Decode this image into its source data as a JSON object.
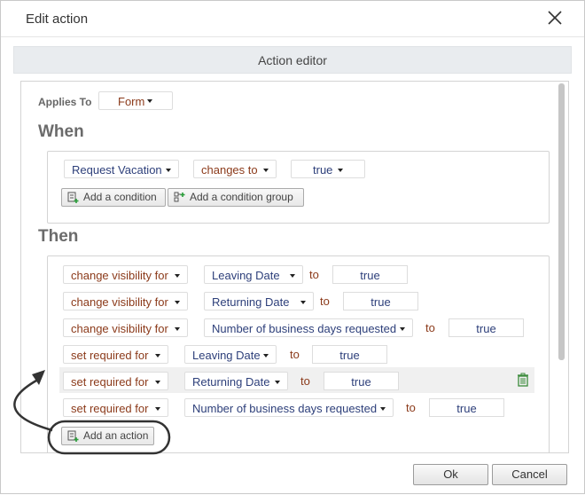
{
  "dialog": {
    "title": "Edit action",
    "close_icon": "close-icon",
    "ok_label": "Ok",
    "cancel_label": "Cancel"
  },
  "editor": {
    "header": "Action editor",
    "applies_to_label": "Applies To",
    "applies_to_value": "Form",
    "when_heading": "When",
    "then_heading": "Then"
  },
  "when": {
    "field": "Request Vacation",
    "operator": "changes to",
    "value": "true",
    "add_condition_label": "Add a condition",
    "add_condition_group_label": "Add a condition group"
  },
  "then": {
    "to_label": "to",
    "actions": [
      {
        "action": "change visibility for",
        "field": "Leaving Date",
        "value": "true"
      },
      {
        "action": "change visibility for",
        "field": "Returning Date",
        "value": "true"
      },
      {
        "action": "change visibility for",
        "field": "Number of business days requested",
        "value": "true"
      },
      {
        "action": "set required for",
        "field": "Leaving Date",
        "value": "true"
      },
      {
        "action": "set required for",
        "field": "Returning Date",
        "value": "true"
      },
      {
        "action": "set required for",
        "field": "Number of business days requested",
        "value": "true"
      }
    ],
    "add_action_label": "Add an action",
    "delete_icon": "trash-icon"
  },
  "colors": {
    "action_text": "#8b3a1a",
    "field_text": "#2d3f7a",
    "callout": "#333333"
  }
}
